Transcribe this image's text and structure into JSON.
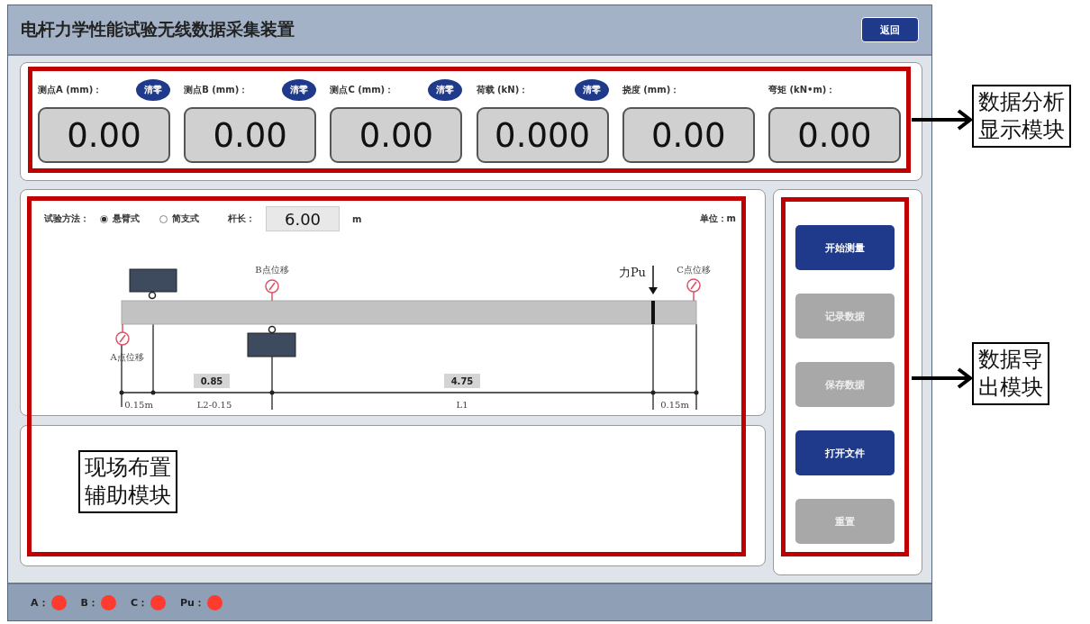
{
  "window": {
    "title": "电杆力学性能试验无线数据采集装置",
    "back_button": "返回"
  },
  "readings": [
    {
      "label": "测点A (mm)：",
      "value": "0.00",
      "clear_button": "清零"
    },
    {
      "label": "测点B (mm)：",
      "value": "0.00",
      "clear_button": "清零"
    },
    {
      "label": "测点C (mm)：",
      "value": "0.00",
      "clear_button": "清零"
    },
    {
      "label": "荷载 (kN)：",
      "value": "0.000",
      "clear_button": "清零"
    },
    {
      "label": "挠度 (mm)：",
      "value": "0.00"
    },
    {
      "label": "弯矩 (kN•m)：",
      "value": "0.00"
    }
  ],
  "test_setup": {
    "method_label": "试验方法：",
    "methods": [
      {
        "label": "悬臂式",
        "selected": true
      },
      {
        "label": "简支式",
        "selected": false
      }
    ],
    "length_label": "杆长：",
    "length_value": "6.00",
    "length_unit": "m",
    "unit_note": "单位：m"
  },
  "diagram": {
    "b_gauge": "B点位移",
    "force": "力Pu",
    "c_gauge": "C点位移",
    "a_gauge": "A点位移",
    "l2_value": "0.85",
    "l1_value": "4.75",
    "left_offset": "0.15m",
    "l2_label": "L2-0.15",
    "l1_label": "L1",
    "right_offset": "0.15m"
  },
  "actions": [
    {
      "label": "开始测量",
      "disabled": false
    },
    {
      "label": "记录数据",
      "disabled": true
    },
    {
      "label": "保存数据",
      "disabled": true
    },
    {
      "label": "打开文件",
      "disabled": false
    },
    {
      "label": "重置",
      "disabled": true
    }
  ],
  "status_bar": [
    {
      "label": "A：",
      "color": "#ff3b30"
    },
    {
      "label": "B：",
      "color": "#ff3b30"
    },
    {
      "label": "C：",
      "color": "#ff3b30"
    },
    {
      "label": "Pu：",
      "color": "#ff3b30"
    }
  ],
  "annotations": [
    {
      "kind": "right-top",
      "lines": [
        "数据分析",
        "显示模块"
      ]
    },
    {
      "kind": "right-middle",
      "lines": [
        "数据导",
        "出模块"
      ]
    },
    {
      "kind": "inside",
      "lines": [
        "现场布置",
        "辅助模块"
      ]
    }
  ]
}
